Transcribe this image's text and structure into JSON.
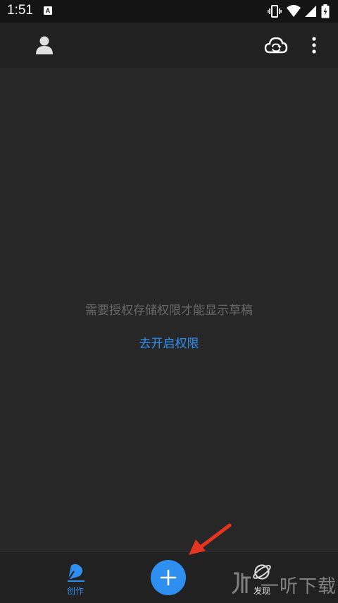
{
  "status_bar": {
    "time": "1:51",
    "notification_badge": "A",
    "icons": [
      "vibrate-icon",
      "wifi-icon",
      "signal-icon",
      "battery-icon"
    ]
  },
  "toolbar": {
    "icons": [
      "profile-icon",
      "cloud-sync-icon",
      "more-vert-icon"
    ]
  },
  "main": {
    "empty_message": "需要授权存储权限才能显示草稿",
    "permission_link": "去开启权限"
  },
  "bottom_nav": {
    "items": [
      {
        "label": "创作",
        "icon": "create-pen-icon",
        "active": true
      },
      {
        "label": "发现",
        "icon": "planet-icon",
        "active": false
      }
    ],
    "fab_icon": "plus-icon"
  },
  "watermark": {
    "text": "一听下载"
  },
  "colors": {
    "accent": "#2f8ff0",
    "background": "#272727",
    "toolbar": "#212121",
    "status_bar": "#141414",
    "message_text": "#676767",
    "annotation_arrow": "#e5341f"
  }
}
